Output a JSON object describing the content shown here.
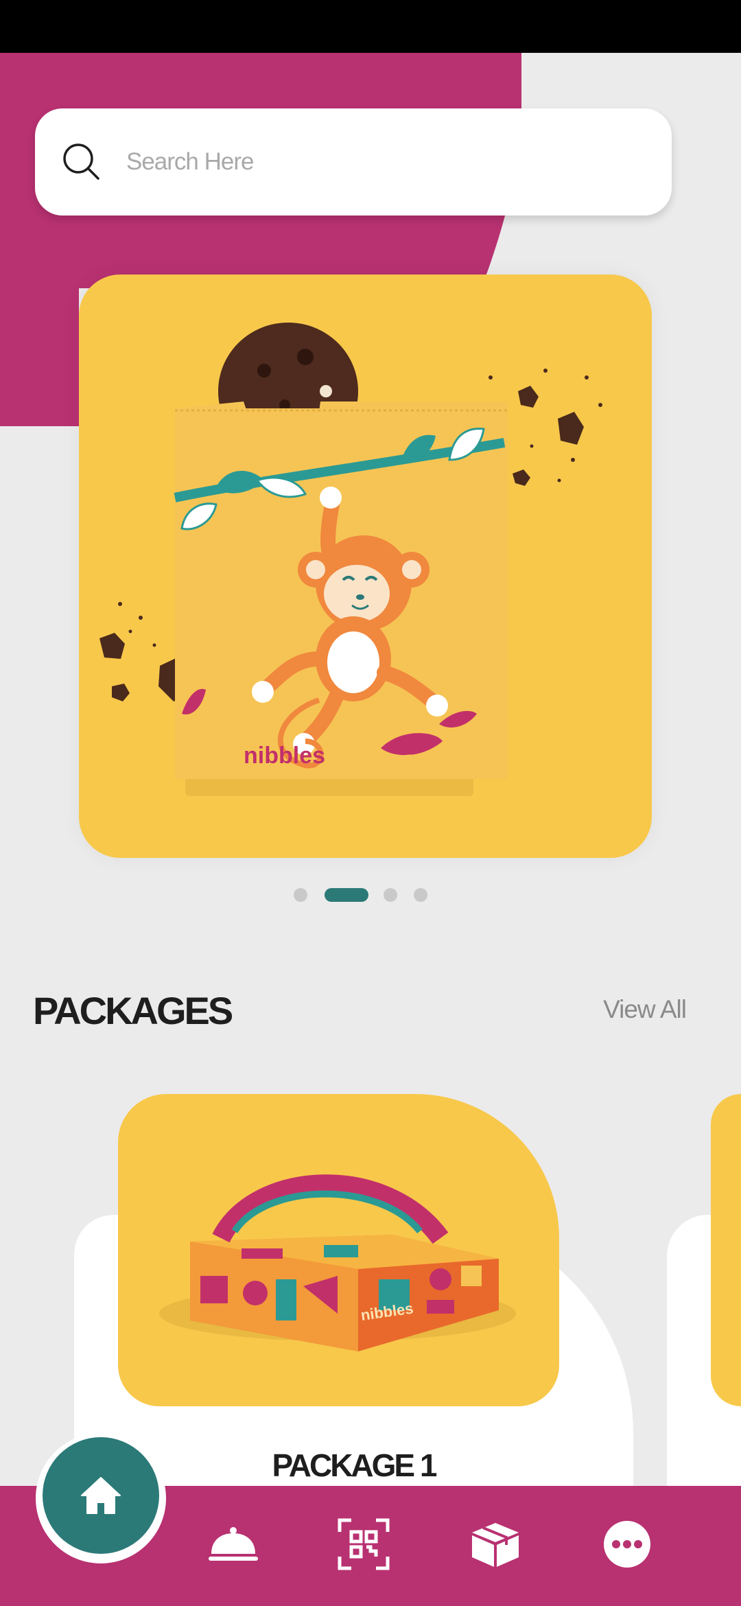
{
  "search": {
    "placeholder": "Search Here",
    "value": ""
  },
  "carousel": {
    "slide_count": 4,
    "active_index": 1,
    "banner_brand_text": "nibbles"
  },
  "packages": {
    "title": "PACKAGES",
    "view_all_label": "View All",
    "items": [
      {
        "name": "PACKAGE 1",
        "box_brand_text": "nibbles"
      }
    ]
  },
  "bottom_nav": {
    "items": [
      {
        "id": "home",
        "icon": "home-icon",
        "active": true
      },
      {
        "id": "menu",
        "icon": "cloche-icon",
        "active": false
      },
      {
        "id": "scan",
        "icon": "qr-scan-icon",
        "active": false
      },
      {
        "id": "packages",
        "icon": "package-box-icon",
        "active": false
      },
      {
        "id": "more",
        "icon": "more-icon",
        "active": false
      }
    ]
  },
  "colors": {
    "brand_magenta": "#b83171",
    "brand_teal": "#2b7a78",
    "brand_yellow": "#f8c84b",
    "background": "#ebebeb"
  }
}
